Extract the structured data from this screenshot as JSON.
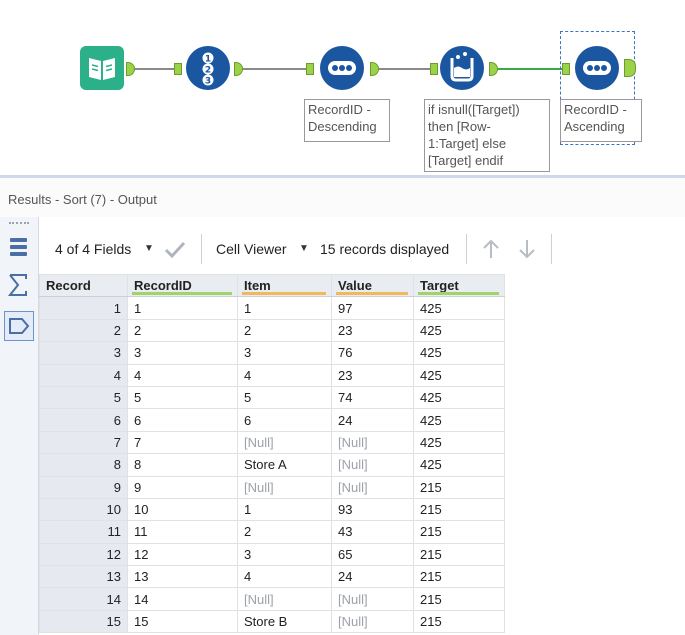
{
  "workflow": {
    "tools": [
      {
        "name": "input-data-tool",
        "icon": "book-icon"
      },
      {
        "name": "record-id-tool",
        "icon": "numbered-list-icon",
        "glyphs": [
          "1",
          "2",
          "3"
        ]
      },
      {
        "name": "sort-tool-descending",
        "icon": "dots-icon"
      },
      {
        "name": "formula-tool",
        "icon": "formula-flask-icon"
      },
      {
        "name": "sort-tool-ascending",
        "icon": "dots-icon"
      }
    ],
    "annotations": {
      "sort_desc": "RecordID -\nDescending",
      "formula": "if isnull([Target])\nthen [Row-\n1:Target] else\n[Target] endif",
      "sort_asc": "RecordID -\nAscending"
    }
  },
  "results": {
    "title": "Results - Sort (7) - Output",
    "fields_label": "4 of 4 Fields",
    "viewer_label": "Cell Viewer",
    "records_label": "15 records displayed"
  },
  "sidebar": {
    "icons": [
      "table-view-icon",
      "sum-icon",
      "tag-icon"
    ]
  },
  "table": {
    "columns": [
      {
        "label": "Record",
        "color": ""
      },
      {
        "label": "RecordID",
        "color": "#a0d468"
      },
      {
        "label": "Item",
        "color": "#f0b95a"
      },
      {
        "label": "Value",
        "color": "#f0b95a"
      },
      {
        "label": "Target",
        "color": "#a0d468"
      }
    ],
    "rows": [
      [
        "1",
        "1",
        "1",
        "97",
        "425"
      ],
      [
        "2",
        "2",
        "2",
        "23",
        "425"
      ],
      [
        "3",
        "3",
        "3",
        "76",
        "425"
      ],
      [
        "4",
        "4",
        "4",
        "23",
        "425"
      ],
      [
        "5",
        "5",
        "5",
        "74",
        "425"
      ],
      [
        "6",
        "6",
        "6",
        "24",
        "425"
      ],
      [
        "7",
        "7",
        "[Null]",
        "[Null]",
        "425"
      ],
      [
        "8",
        "8",
        "Store A",
        "[Null]",
        "425"
      ],
      [
        "9",
        "9",
        "[Null]",
        "[Null]",
        "215"
      ],
      [
        "10",
        "10",
        "1",
        "93",
        "215"
      ],
      [
        "11",
        "11",
        "2",
        "43",
        "215"
      ],
      [
        "12",
        "12",
        "3",
        "65",
        "215"
      ],
      [
        "13",
        "13",
        "4",
        "24",
        "215"
      ],
      [
        "14",
        "14",
        "[Null]",
        "[Null]",
        "215"
      ],
      [
        "15",
        "15",
        "Store B",
        "[Null]",
        "215"
      ]
    ],
    "null_color": "#9da2aa"
  },
  "colors": {
    "tool_blue": "#1b56a0",
    "tool_teal": "#2bb089",
    "anchor_green": "#9bd24a",
    "selection": "#3a75c4"
  }
}
